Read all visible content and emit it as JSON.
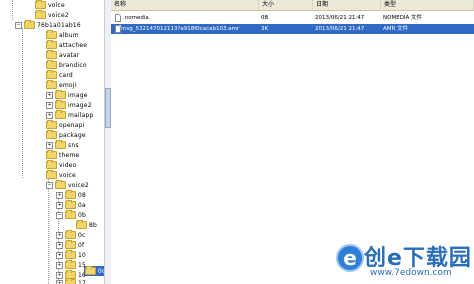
{
  "tree": {
    "items": [
      {
        "label": "voice"
      },
      {
        "label": "voice2"
      },
      {
        "label": "76b1a01ab16"
      },
      {
        "label": "album"
      },
      {
        "label": "attachee"
      },
      {
        "label": "avatar"
      },
      {
        "label": "brandico"
      },
      {
        "label": "card"
      },
      {
        "label": "emoji"
      },
      {
        "label": "image"
      },
      {
        "label": "image2"
      },
      {
        "label": "mailapp"
      },
      {
        "label": "openapi"
      },
      {
        "label": "package"
      },
      {
        "label": "sns"
      },
      {
        "label": "theme"
      },
      {
        "label": "video"
      },
      {
        "label": "voice"
      },
      {
        "label": "voice2"
      },
      {
        "label": "08"
      },
      {
        "label": "0a"
      },
      {
        "label": "0b"
      },
      {
        "label": "8b"
      },
      {
        "label": "0c"
      },
      {
        "label": "0f"
      },
      {
        "label": "10"
      },
      {
        "label": "15"
      },
      {
        "label": "16"
      },
      {
        "label": "17"
      },
      {
        "label": "0c"
      }
    ]
  },
  "list": {
    "columns": {
      "name": "名称",
      "size": "大小",
      "date": "日期",
      "type": "类型"
    },
    "rows": [
      {
        "name": ".nomedia",
        "size": "0B",
        "date": "2013/06/21 21:47",
        "type": "NOMEDIA 文件",
        "selected": false
      },
      {
        "name": "msg_532147012113?a918f0cacab103.amr",
        "size": "3K",
        "date": "2013/06/21 21:47",
        "type": "AMR 文件",
        "selected": true
      }
    ]
  },
  "watermark": {
    "logo": "e",
    "text": "创e下载园",
    "url": "www.7edown.com"
  }
}
